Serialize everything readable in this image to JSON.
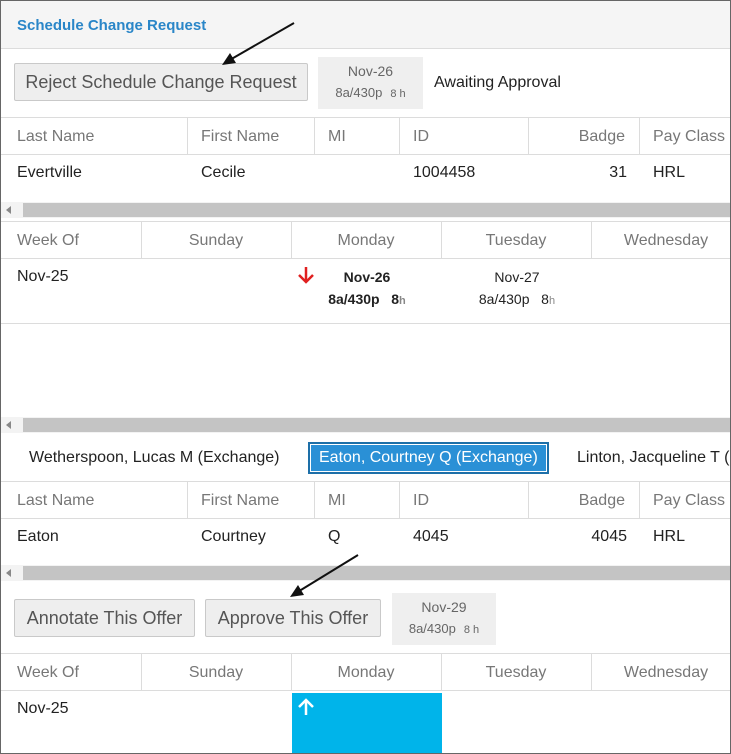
{
  "header": {
    "title": "Schedule Change Request"
  },
  "request": {
    "reject_label": "Reject Schedule Change Request",
    "shift": {
      "date": "Nov-26",
      "time": "8a/430p",
      "hours": "8 h"
    },
    "status": "Awaiting Approval"
  },
  "employee_table": {
    "columns": [
      "Last Name",
      "First Name",
      "MI",
      "ID",
      "Badge",
      "Pay Class"
    ],
    "row": {
      "last": "Evertville",
      "first": "Cecile",
      "mi": "",
      "id": "1004458",
      "badge": "31",
      "pay_class": "HRL"
    }
  },
  "week_table": {
    "columns": [
      "Week Of",
      "Sunday",
      "Monday",
      "Tuesday",
      "Wednesday"
    ],
    "week_of": "Nov-25",
    "monday": {
      "date": "Nov-26",
      "time": "8a/430p",
      "hours": "8",
      "unit": "h"
    },
    "tuesday": {
      "date": "Nov-27",
      "time": "8a/430p",
      "hours": "8",
      "unit": "h"
    }
  },
  "offers": {
    "tabs": [
      "Wetherspoon, Lucas M (Exchange)",
      "Eaton, Courtney Q (Exchange)",
      "Linton, Jacqueline T ("
    ],
    "active_tab": 1
  },
  "offer_table": {
    "columns": [
      "Last Name",
      "First Name",
      "MI",
      "ID",
      "Badge",
      "Pay Class"
    ],
    "row": {
      "last": "Eaton",
      "first": "Courtney",
      "mi": "Q",
      "id": "4045",
      "badge": "4045",
      "pay_class": "HRL"
    }
  },
  "offer_actions": {
    "annotate_label": "Annotate This Offer",
    "approve_label": "Approve This Offer",
    "shift": {
      "date": "Nov-29",
      "time": "8a/430p",
      "hours": "8 h"
    }
  },
  "offer_week_table": {
    "columns": [
      "Week Of",
      "Sunday",
      "Monday",
      "Tuesday",
      "Wednesday"
    ],
    "week_of": "Nov-25"
  },
  "colors": {
    "accent": "#2a86c8",
    "active_tab": "#2a90d6",
    "offer_highlight": "#00b4ea",
    "down_arrow": "#e02020"
  },
  "icons": {
    "down_arrow": "arrow-down-icon",
    "up_arrow": "arrow-up-icon",
    "scroll_left": "chevron-left-icon"
  }
}
